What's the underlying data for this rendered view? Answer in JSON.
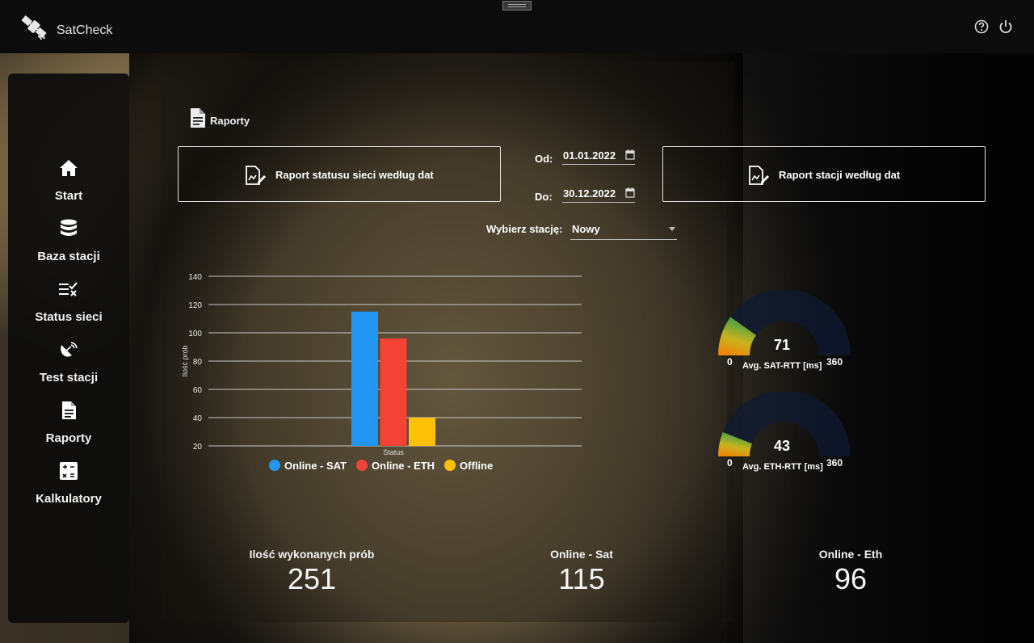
{
  "app": {
    "title": "SatCheck"
  },
  "topbar": {
    "help_icon": "help-circle-icon",
    "power_icon": "power-icon"
  },
  "sidebar": {
    "items": [
      {
        "label": "Start",
        "icon": "home-icon"
      },
      {
        "label": "Baza stacji",
        "icon": "database-icon"
      },
      {
        "label": "Status sieci",
        "icon": "checklist-icon"
      },
      {
        "label": "Test stacji",
        "icon": "satellite-dish-icon"
      },
      {
        "label": "Raporty",
        "icon": "document-icon"
      },
      {
        "label": "Kalkulatory",
        "icon": "calculator-icon"
      }
    ]
  },
  "page": {
    "title": "Raporty"
  },
  "buttons": {
    "network_report": "Raport statusu sieci według dat",
    "station_report": "Raport stacji według dat"
  },
  "filters": {
    "from_label": "Od:",
    "from_value": "01.01.2022",
    "to_label": "Do:",
    "to_value": "30.12.2022",
    "station_label": "Wybierz stację:",
    "station_value": "Nowy"
  },
  "chart_data": {
    "type": "bar",
    "categories": [
      "Status"
    ],
    "series": [
      {
        "name": "Online - SAT",
        "values": [
          115
        ],
        "color": "#2196f3"
      },
      {
        "name": "Online - ETH",
        "values": [
          96
        ],
        "color": "#f44336"
      },
      {
        "name": "Offline",
        "values": [
          40
        ],
        "color": "#ffc107"
      }
    ],
    "xlabel": "Status",
    "ylabel": "Ilość prób",
    "ylim": [
      20,
      140
    ],
    "yticks": [
      20,
      40,
      60,
      80,
      100,
      120,
      140
    ],
    "grid": true,
    "legend": "bottom"
  },
  "gauges": [
    {
      "value": 71,
      "min": 0,
      "max": 360,
      "label": "Avg. SAT-RTT [ms]"
    },
    {
      "value": 43,
      "min": 0,
      "max": 360,
      "label": "Avg. ETH-RTT [ms]"
    }
  ],
  "stats": [
    {
      "label": "Ilość wykonanych prób",
      "value": "251"
    },
    {
      "label": "Online - Sat",
      "value": "115"
    },
    {
      "label": "Online - Eth",
      "value": "96"
    }
  ]
}
